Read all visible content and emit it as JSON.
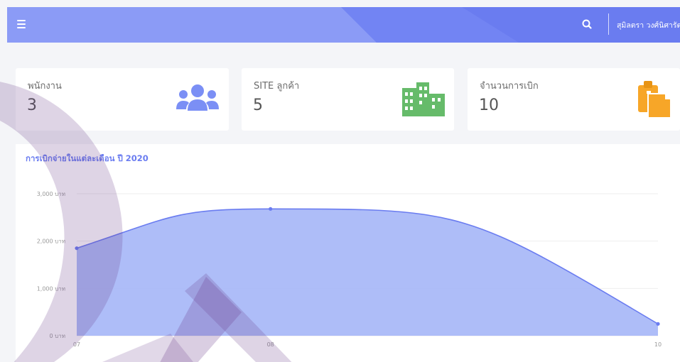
{
  "header": {
    "user_name": "สุมิลตรา วงศ์นิศารัตน์",
    "menu_icon": "hamburger-icon",
    "search_icon": "search-icon",
    "color": "#7b8ff5"
  },
  "stats": [
    {
      "label": "พนักงาน",
      "value": "3",
      "icon": "users-icon",
      "color": "#7b8ff5"
    },
    {
      "label": "SITE ลูกค้า",
      "value": "5",
      "icon": "building-icon",
      "color": "#66bb6a"
    },
    {
      "label": "จำนวนการเบิก",
      "value": "10",
      "icon": "clipboard-icon",
      "color": "#f7a628"
    }
  ],
  "chart_title": "การเบิกจ่ายในแต่ละเดือน ปี 2020",
  "chart_data": {
    "type": "area",
    "title": "การเบิกจ่ายในแต่ละเดือน ปี 2020",
    "categories": [
      "07",
      "08",
      "10"
    ],
    "values": [
      1850,
      2680,
      250
    ],
    "ylim": [
      0,
      3000
    ],
    "yticks": [
      0,
      1000,
      2000,
      3000
    ],
    "ytick_labels": [
      "0 บาท",
      "1,000 บาท",
      "2,000 บาท",
      "3,000 บาท"
    ],
    "grid": true,
    "smooth": true,
    "line_color": "#6a7cf0",
    "fill_color": "#a5b6f7"
  }
}
